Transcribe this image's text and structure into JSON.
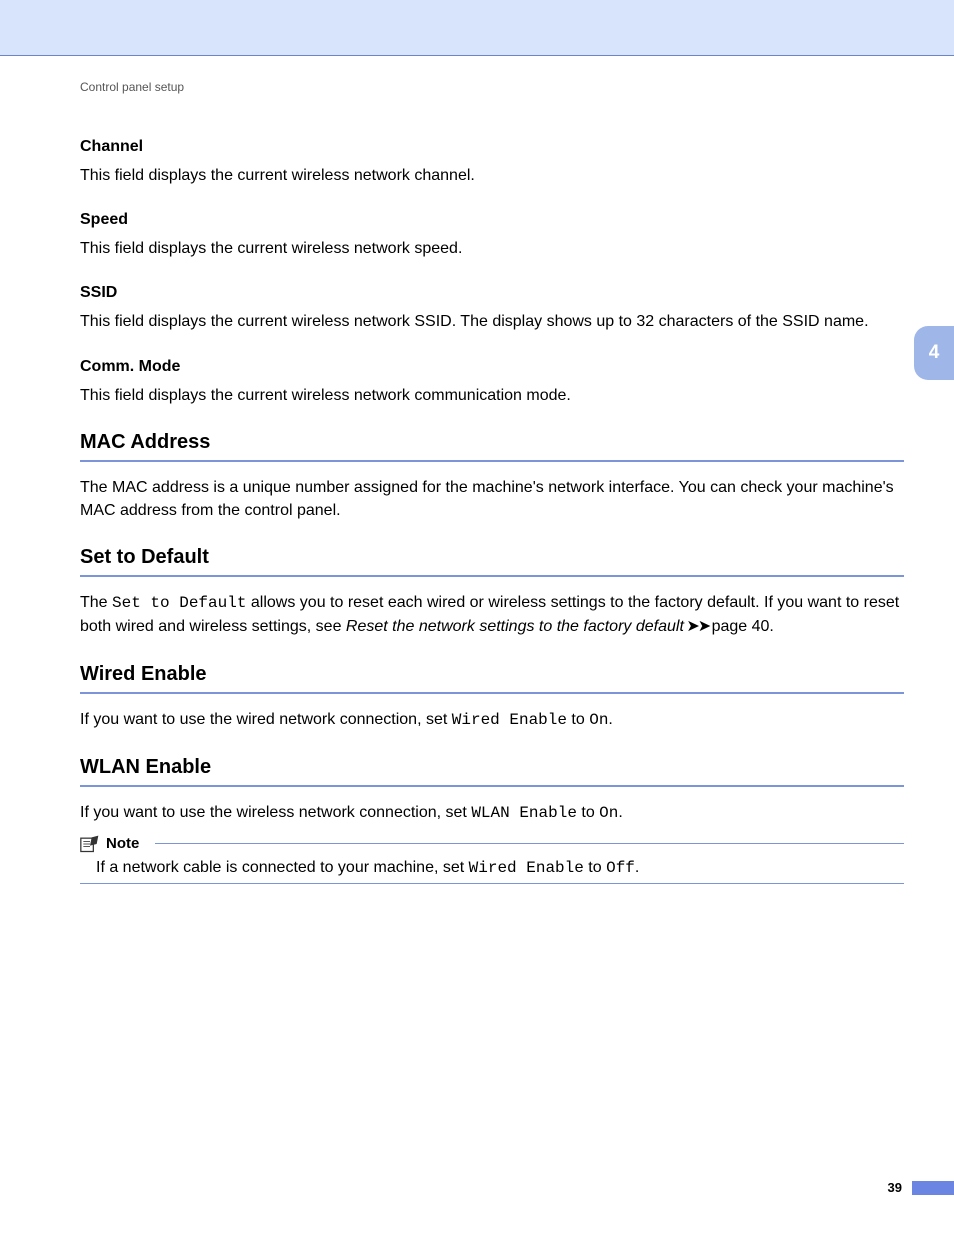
{
  "breadcrumb": "Control panel setup",
  "chapter_tab": "4",
  "page_number": "39",
  "sections": {
    "channel": {
      "title": "Channel",
      "body": "This field displays the current wireless network channel."
    },
    "speed": {
      "title": "Speed",
      "body": "This field displays the current wireless network speed."
    },
    "ssid": {
      "title": "SSID",
      "body": "This field displays the current wireless network SSID. The display shows up to 32 characters of the SSID name."
    },
    "comm_mode": {
      "title": "Comm. Mode",
      "body": "This field displays the current wireless network communication mode."
    },
    "mac_address": {
      "title": "MAC Address",
      "body": "The MAC address is a unique number assigned for the machine's network interface. You can check your machine's MAC address from the control panel."
    },
    "set_to_default": {
      "title": "Set to Default",
      "prefix": "The ",
      "mono1": "Set to Default",
      "mid1": " allows you to reset each wired or wireless settings to the factory default. If you want to reset both wired and wireless settings, see ",
      "ital": "Reset the network settings to the factory default",
      "arrows": " ➤➤ ",
      "mid2": "page 40."
    },
    "wired_enable": {
      "title": "Wired Enable",
      "prefix": "If you want to use the wired network connection, set ",
      "mono1": "Wired Enable",
      "mid": " to ",
      "mono2": "On",
      "suffix": "."
    },
    "wlan_enable": {
      "title": "WLAN Enable",
      "prefix": "If you want to use the wireless network connection, set ",
      "mono1": "WLAN Enable",
      "mid": " to ",
      "mono2": "On",
      "suffix": "."
    },
    "note": {
      "label": "Note",
      "prefix": "If a network cable is connected to your machine, set ",
      "mono1": "Wired Enable",
      "mid": " to ",
      "mono2": "Off",
      "suffix": "."
    }
  }
}
